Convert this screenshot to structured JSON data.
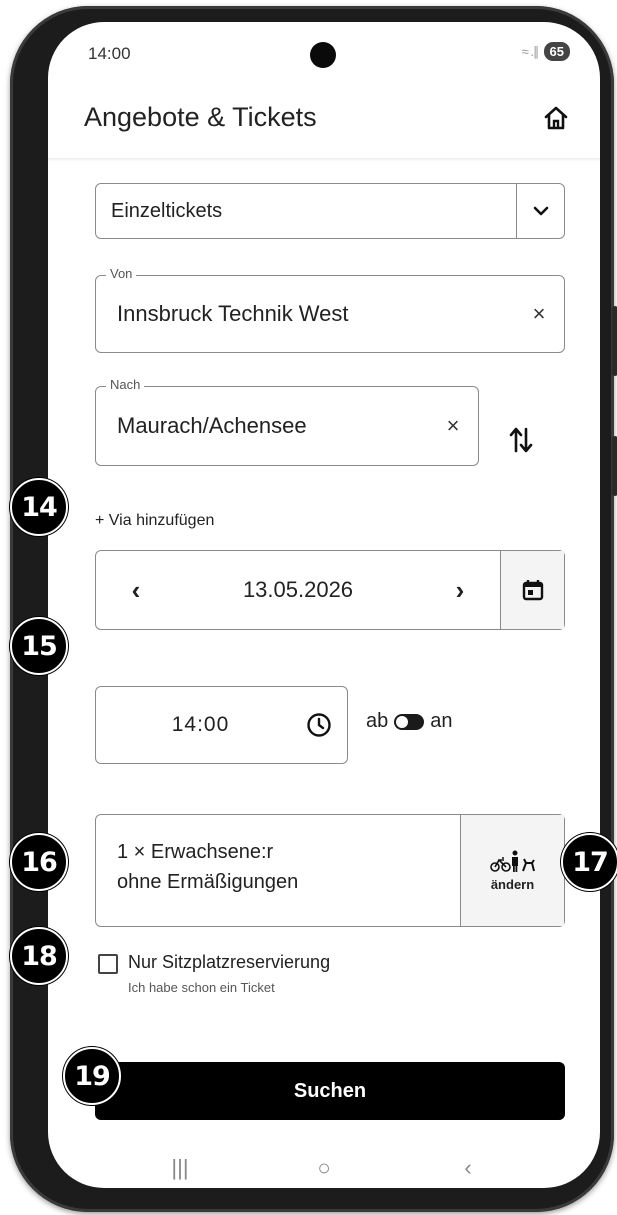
{
  "status": {
    "time": "14:00",
    "signal": "≈ .∥",
    "battery": "65"
  },
  "header": {
    "title": "Angebote & Tickets"
  },
  "ticket_type": {
    "selected": "Einzeltickets"
  },
  "from": {
    "legend": "Von",
    "value": "Innsbruck Technik West",
    "clear": "×"
  },
  "to": {
    "legend": "Nach",
    "value": "Maurach/Achensee",
    "clear": "×"
  },
  "via": {
    "label": "+ Via hinzufügen"
  },
  "date": {
    "prev": "‹",
    "value": "13.05.2026",
    "next": "›"
  },
  "time": {
    "value": "14:00",
    "ab": "ab",
    "an": "an"
  },
  "passengers": {
    "line1": "1 × Erwachsene:r",
    "line2": "ohne Ermäßigungen",
    "change": "ändern"
  },
  "seat_only": {
    "label": "Nur Sitzplatzreservierung",
    "hint": "Ich habe schon ein Ticket"
  },
  "search": {
    "label": "Suchen"
  },
  "navbar": {
    "recents": "|||",
    "home": "○",
    "back": "‹"
  },
  "annotations": [
    "14",
    "15",
    "16",
    "17",
    "18",
    "19"
  ]
}
